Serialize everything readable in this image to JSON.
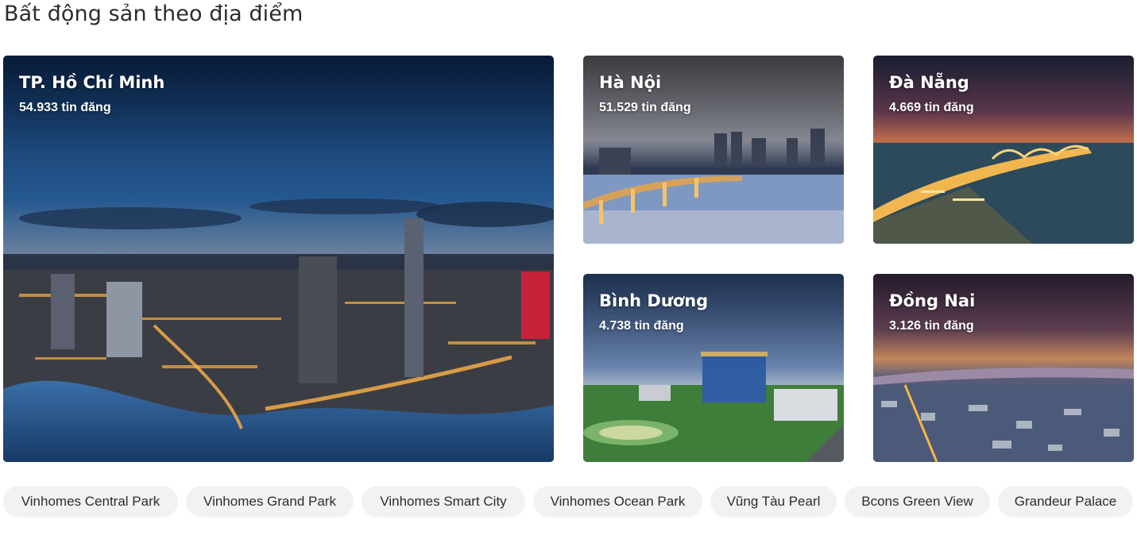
{
  "section": {
    "title": "Bất động sản theo địa điểm"
  },
  "locations": [
    {
      "name": "TP. Hồ Chí Minh",
      "count": "54.933 tin đăng"
    },
    {
      "name": "Hà Nội",
      "count": "51.529 tin đăng"
    },
    {
      "name": "Đà Nẵng",
      "count": "4.669 tin đăng"
    },
    {
      "name": "Bình Dương",
      "count": "4.738 tin đăng"
    },
    {
      "name": "Đồng Nai",
      "count": "3.126 tin đăng"
    }
  ],
  "projects": [
    "Vinhomes Central Park",
    "Vinhomes Grand Park",
    "Vinhomes Smart City",
    "Vinhomes Ocean Park",
    "Vũng Tàu Pearl",
    "Bcons Green View",
    "Grandeur Palace"
  ],
  "colors": {
    "chip_background": "#f2f2f2",
    "text": "#2c2c2c",
    "card_text": "#ffffff"
  }
}
